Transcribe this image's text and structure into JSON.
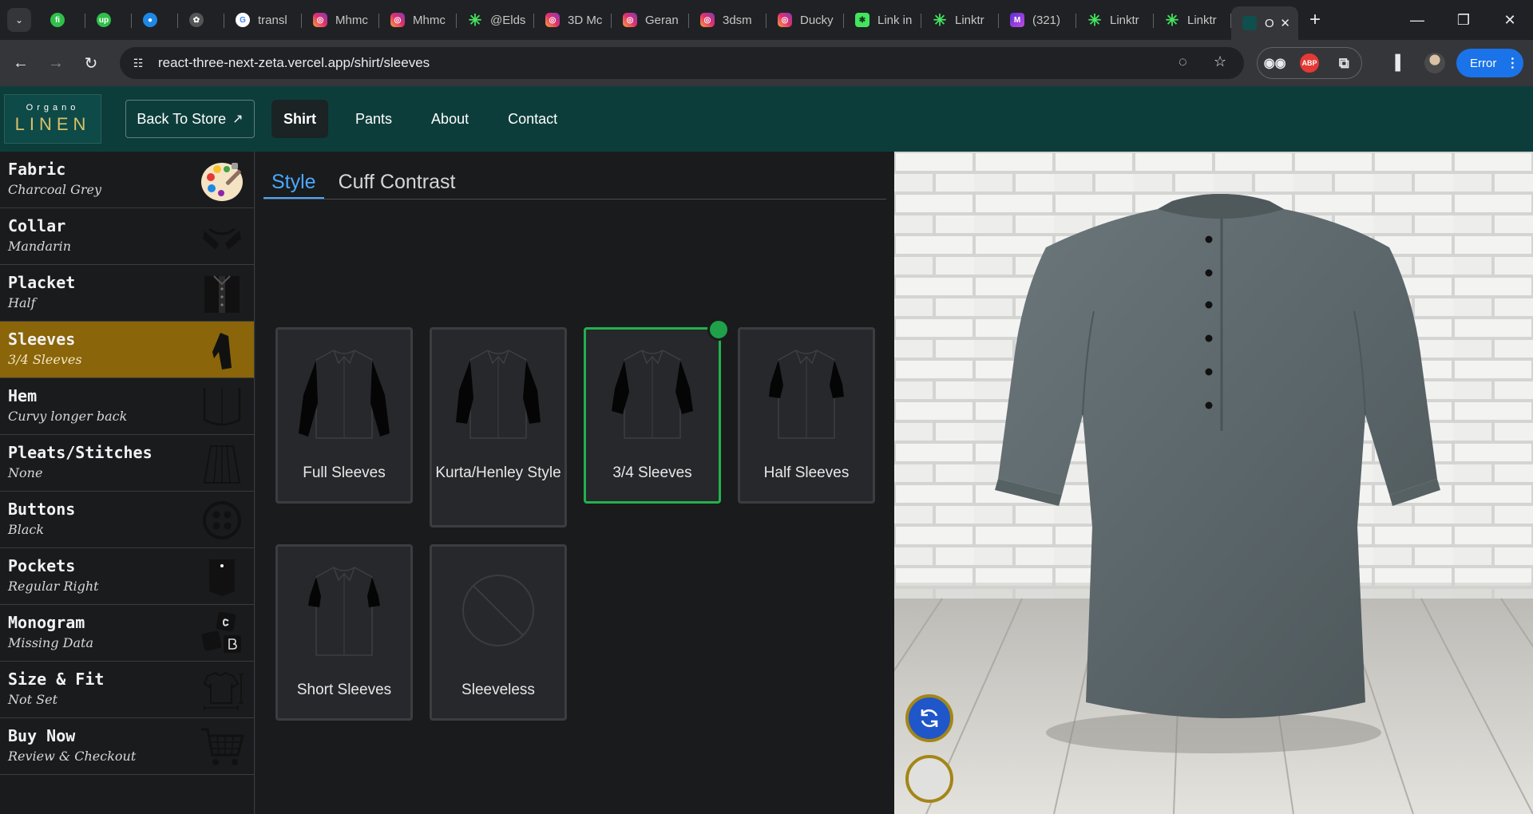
{
  "browser": {
    "tabs": [
      {
        "icon": "fiverr-icon",
        "title": ""
      },
      {
        "icon": "upwork-icon",
        "title": ""
      },
      {
        "icon": "circle-app-icon",
        "title": ""
      },
      {
        "icon": "chatgpt-icon",
        "title": ""
      },
      {
        "icon": "google-icon",
        "title": "transl"
      },
      {
        "icon": "instagram-icon",
        "title": "Mhmc"
      },
      {
        "icon": "instagram-icon",
        "title": "Mhmc"
      },
      {
        "icon": "linktree-icon",
        "title": "@Elds"
      },
      {
        "icon": "instagram-icon",
        "title": "3D Mc"
      },
      {
        "icon": "instagram-icon",
        "title": "Geran"
      },
      {
        "icon": "instagram-icon",
        "title": "3dsm"
      },
      {
        "icon": "instagram-icon",
        "title": "Ducky"
      },
      {
        "icon": "linktree-icon",
        "title": "Link in"
      },
      {
        "icon": "linktree-icon",
        "title": "Linktr"
      },
      {
        "icon": "gmail-icon",
        "title": "(321)"
      },
      {
        "icon": "linktree-icon",
        "title": "Linktr"
      },
      {
        "icon": "linktree-icon",
        "title": "Linktr"
      },
      {
        "icon": "organo-icon",
        "title": "O"
      }
    ],
    "url": "react-three-next-zeta.vercel.app/shirt/sleeves",
    "profile_status": "Error",
    "extensions": [
      "glasses-extension-icon",
      "ABP",
      "puzzle-extension-icon"
    ]
  },
  "header": {
    "logo_top": "Organo",
    "logo_bottom": "LINEN",
    "back_label": "Back To Store",
    "nav": [
      {
        "label": "Shirt",
        "active": true
      },
      {
        "label": "Pants",
        "active": false
      },
      {
        "label": "About",
        "active": false
      },
      {
        "label": "Contact",
        "active": false
      }
    ]
  },
  "sidebar": {
    "items": [
      {
        "title": "Fabric",
        "value": "Charcoal Grey",
        "icon": "palette-icon"
      },
      {
        "title": "Collar",
        "value": "Mandarin",
        "icon": "collar-icon"
      },
      {
        "title": "Placket",
        "value": "Half",
        "icon": "placket-icon"
      },
      {
        "title": "Sleeves",
        "value": "3/4 Sleeves",
        "icon": "sleeve-icon",
        "active": true
      },
      {
        "title": "Hem",
        "value": "Curvy longer back",
        "icon": "hem-icon"
      },
      {
        "title": "Pleats/Stitches",
        "value": "None",
        "icon": "pleats-icon"
      },
      {
        "title": "Buttons",
        "value": "Black",
        "icon": "button-icon"
      },
      {
        "title": "Pockets",
        "value": "Regular Right",
        "icon": "pocket-icon"
      },
      {
        "title": "Monogram",
        "value": "Missing Data",
        "icon": "monogram-icon"
      },
      {
        "title": "Size & Fit",
        "value": "Not Set",
        "icon": "size-fit-icon"
      },
      {
        "title": "Buy Now",
        "value": "Review & Checkout",
        "icon": "cart-icon"
      }
    ]
  },
  "panel": {
    "tabs": [
      {
        "label": "Style",
        "active": true
      },
      {
        "label": "Cuff Contrast",
        "active": false
      }
    ],
    "options": [
      {
        "label": "Full Sleeves",
        "selected": false
      },
      {
        "label": "Kurta/Henley Style",
        "selected": false
      },
      {
        "label": "3/4 Sleeves",
        "selected": true
      },
      {
        "label": "Half Sleeves",
        "selected": false
      },
      {
        "label": "Short Sleeves",
        "selected": false
      },
      {
        "label": "Sleeveless",
        "selected": false
      }
    ]
  },
  "viewer": {
    "controls": [
      "rotate-icon",
      "environment-toggle"
    ]
  },
  "colors": {
    "header_bg": "#0d3d3b",
    "active_sidebar": "#8a6509",
    "selected_option": "#22b14c",
    "active_tab": "#4aa8ff",
    "rotate_button": "#1f56c9",
    "shirt_fabric": "#5c676b"
  }
}
